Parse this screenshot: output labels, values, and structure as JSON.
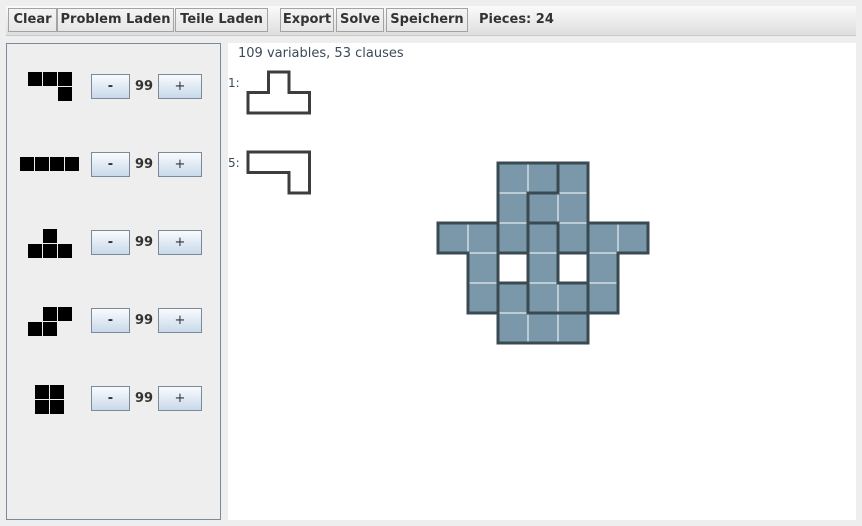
{
  "toolbar": {
    "buttons": [
      {
        "id": "clear",
        "label": "Clear"
      },
      {
        "id": "problem-laden",
        "label": "Problem Laden"
      },
      {
        "id": "teile-laden",
        "label": "Teile Laden"
      },
      {
        "id": "export",
        "label": "Export"
      },
      {
        "id": "solve",
        "label": "Solve"
      },
      {
        "id": "speichern",
        "label": "Speichern"
      }
    ],
    "pieces_label": "Pieces: 24"
  },
  "piece_palette": [
    {
      "name": "j-tetromino",
      "cells": [
        [
          0,
          0
        ],
        [
          1,
          0
        ],
        [
          2,
          0
        ],
        [
          2,
          1
        ]
      ],
      "count": "99",
      "minus": "-",
      "plus": "+"
    },
    {
      "name": "i-tetromino",
      "cells": [
        [
          0,
          0
        ],
        [
          1,
          0
        ],
        [
          2,
          0
        ],
        [
          3,
          0
        ]
      ],
      "count": "99",
      "minus": "-",
      "plus": "+"
    },
    {
      "name": "t-tetromino",
      "cells": [
        [
          1,
          0
        ],
        [
          0,
          1
        ],
        [
          1,
          1
        ],
        [
          2,
          1
        ]
      ],
      "count": "99",
      "minus": "-",
      "plus": "+"
    },
    {
      "name": "s-tetromino",
      "cells": [
        [
          1,
          0
        ],
        [
          2,
          0
        ],
        [
          0,
          1
        ],
        [
          1,
          1
        ]
      ],
      "count": "99",
      "minus": "-",
      "plus": "+"
    },
    {
      "name": "o-tetromino",
      "cells": [
        [
          0,
          0
        ],
        [
          1,
          0
        ],
        [
          0,
          1
        ],
        [
          1,
          1
        ]
      ],
      "count": "99",
      "minus": "-",
      "plus": "+"
    }
  ],
  "canvas": {
    "status": "109 variables, 53 clauses",
    "solution_pieces": [
      {
        "label": "1:",
        "cells": [
          [
            1,
            0
          ],
          [
            0,
            1
          ],
          [
            1,
            1
          ],
          [
            2,
            1
          ]
        ]
      },
      {
        "label": "5:",
        "cells": [
          [
            0,
            0
          ],
          [
            1,
            0
          ],
          [
            2,
            0
          ],
          [
            2,
            1
          ]
        ]
      }
    ],
    "board": {
      "fill_color": "#7b98aa",
      "border_color": "#3a4a52",
      "pieces": [
        [
          [
            2,
            0
          ],
          [
            3,
            0
          ],
          [
            2,
            1
          ],
          [
            2,
            2
          ]
        ],
        [
          [
            4,
            0
          ],
          [
            4,
            1
          ],
          [
            3,
            1
          ],
          [
            4,
            2
          ]
        ],
        [
          [
            0,
            2
          ],
          [
            1,
            2
          ],
          [
            1,
            3
          ],
          [
            1,
            4
          ]
        ],
        [
          [
            3,
            2
          ],
          [
            3,
            3
          ],
          [
            3,
            4
          ],
          [
            4,
            4
          ]
        ],
        [
          [
            5,
            2
          ],
          [
            6,
            2
          ],
          [
            5,
            3
          ],
          [
            5,
            4
          ]
        ],
        [
          [
            2,
            4
          ],
          [
            2,
            5
          ],
          [
            3,
            5
          ],
          [
            4,
            5
          ]
        ]
      ]
    }
  }
}
